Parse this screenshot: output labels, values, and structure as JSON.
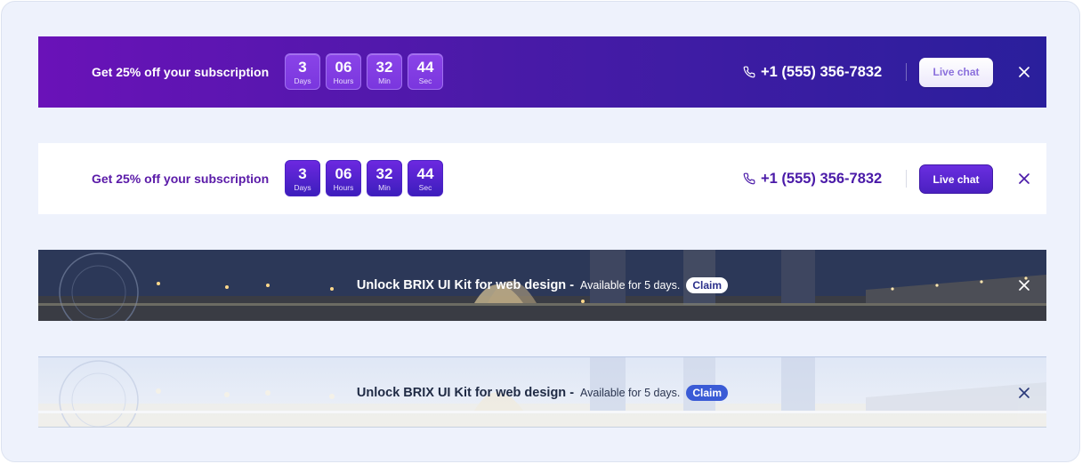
{
  "banners": [
    {
      "promo": "Get 25% off your subscription",
      "timer": [
        {
          "value": "3",
          "label": "Days"
        },
        {
          "value": "06",
          "label": "Hours"
        },
        {
          "value": "32",
          "label": "Min"
        },
        {
          "value": "44",
          "label": "Sec"
        }
      ],
      "phone": "+1 (555) 356-7832",
      "chat_label": "Live chat"
    },
    {
      "promo": "Get 25% off your subscription",
      "timer": [
        {
          "value": "3",
          "label": "Days"
        },
        {
          "value": "06",
          "label": "Hours"
        },
        {
          "value": "32",
          "label": "Min"
        },
        {
          "value": "44",
          "label": "Sec"
        }
      ],
      "phone": "+1 (555) 356-7832",
      "chat_label": "Live chat"
    },
    {
      "title": "Unlock BRIX UI Kit for web design -",
      "subtitle": "Available for 5 days.",
      "claim_label": "Claim"
    },
    {
      "title": "Unlock BRIX UI Kit for web design -",
      "subtitle": "Available for 5 days.",
      "claim_label": "Claim"
    }
  ],
  "colors": {
    "purple_start": "#6a12b8",
    "purple_end": "#2a1f9c",
    "accent": "#4a1aa8",
    "claim_blue": "#3a5bd6"
  },
  "icons": [
    "phone-icon",
    "close-icon"
  ]
}
